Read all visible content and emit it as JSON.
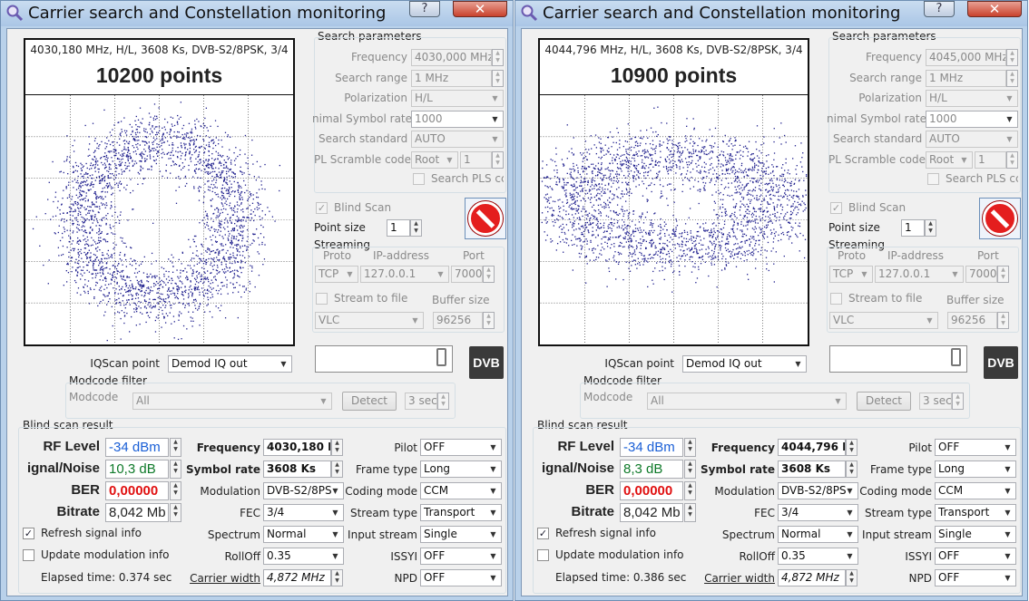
{
  "windows": [
    {
      "title": "Carrier search and Constellation monitoring",
      "plot": {
        "info": "4030,180 MHz, H/L, 3608 Ks, DVB-S2/8PSK, 3/4",
        "points": "10200 points"
      },
      "search": {
        "group": "Search parameters",
        "frequency_label": "Frequency",
        "frequency": "4030,000 MHz",
        "range_label": "Search range",
        "range": "1 MHz",
        "pol_label": "Polarization",
        "pol": "H/L",
        "minsr_label": "nimal Symbol rate",
        "minsr": "1000",
        "std_label": "Search standard",
        "std": "AUTO",
        "pls_label": "PL Scramble code",
        "pls_mode": "Root",
        "pls_val": "1",
        "searchpls": "Search PLS cc"
      },
      "blind": {
        "label": "Blind Scan",
        "pointsize_label": "Point size",
        "pointsize": "1"
      },
      "streaming": {
        "group": "Streaming",
        "proto_label": "Proto",
        "ip_label": "IP-address",
        "port_label": "Port",
        "proto": "TCP",
        "ip": "127.0.0.1",
        "port": "7000",
        "tofile": "Stream to file",
        "buffer_label": "Buffer size",
        "player": "VLC",
        "buffer": "96256"
      },
      "iq": {
        "label": "IQScan point",
        "value": "Demod IQ out"
      },
      "lcd": "0",
      "dvb": "DVB",
      "modcode": {
        "group": "Modcode filter",
        "label": "Modcode",
        "value": "All",
        "detect": "Detect",
        "secs": "3 sec"
      },
      "result": {
        "group": "Blind scan result",
        "rf_label": "RF Level",
        "rf": "-34 dBm",
        "sn_label": "ignal/Noise",
        "sn": "10,3 dB",
        "ber_label": "BER",
        "ber": "0,00000",
        "bitrate_label": "Bitrate",
        "bitrate": "8,042 Mb",
        "freq_label": "Frequency",
        "freq": "4030,180 M",
        "sr_label": "Symbol rate",
        "sr": "3608 Ks",
        "mod_label": "Modulation",
        "mod": "DVB-S2/8PS",
        "fec_label": "FEC",
        "fec": "3/4",
        "spectrum_label": "Spectrum",
        "spectrum": "Normal",
        "rolloff_label": "RollOff",
        "rolloff": "0.35",
        "carrier_label": "Carrier width",
        "carrier": "4,872 MHz",
        "pilot_label": "Pilot",
        "pilot": "OFF",
        "frame_label": "Frame type",
        "frame": "Long",
        "coding_label": "Coding mode",
        "coding": "CCM",
        "stype_label": "Stream type",
        "stype": "Transport",
        "input_label": "Input stream",
        "input": "Single",
        "issyi_label": "ISSYI",
        "issyi": "OFF",
        "npd_label": "NPD",
        "npd": "OFF",
        "refresh": "Refresh signal info",
        "update": "Update modulation info",
        "elapsed": "Elapsed time: 0.374 sec"
      }
    },
    {
      "title": "Carrier search and Constellation monitoring",
      "plot": {
        "info": "4044,796 MHz, H/L, 3608 Ks, DVB-S2/8PSK, 3/4",
        "points": "10900 points"
      },
      "search": {
        "group": "Search parameters",
        "frequency_label": "Frequency",
        "frequency": "4045,000 MHz",
        "range_label": "Search range",
        "range": "1 MHz",
        "pol_label": "Polarization",
        "pol": "H/L",
        "minsr_label": "nimal Symbol rate",
        "minsr": "1000",
        "std_label": "Search standard",
        "std": "AUTO",
        "pls_label": "PL Scramble code",
        "pls_mode": "Root",
        "pls_val": "1",
        "searchpls": "Search PLS cc"
      },
      "blind": {
        "label": "Blind Scan",
        "pointsize_label": "Point size",
        "pointsize": "1"
      },
      "streaming": {
        "group": "Streaming",
        "proto_label": "Proto",
        "ip_label": "IP-address",
        "port_label": "Port",
        "proto": "TCP",
        "ip": "127.0.0.1",
        "port": "7000",
        "tofile": "Stream to file",
        "buffer_label": "Buffer size",
        "player": "VLC",
        "buffer": "96256"
      },
      "iq": {
        "label": "IQScan point",
        "value": "Demod IQ out"
      },
      "lcd": "0",
      "dvb": "DVB",
      "modcode": {
        "group": "Modcode filter",
        "label": "Modcode",
        "value": "All",
        "detect": "Detect",
        "secs": "3 sec"
      },
      "result": {
        "group": "Blind scan result",
        "rf_label": "RF Level",
        "rf": "-34 dBm",
        "sn_label": "ignal/Noise",
        "sn": "8,3 dB",
        "ber_label": "BER",
        "ber": "0,00000",
        "bitrate_label": "Bitrate",
        "bitrate": "8,042 Mb",
        "freq_label": "Frequency",
        "freq": "4044,796 M",
        "sr_label": "Symbol rate",
        "sr": "3608 Ks",
        "mod_label": "Modulation",
        "mod": "DVB-S2/8PS",
        "fec_label": "FEC",
        "fec": "3/4",
        "spectrum_label": "Spectrum",
        "spectrum": "Normal",
        "rolloff_label": "RollOff",
        "rolloff": "0.35",
        "carrier_label": "Carrier width",
        "carrier": "4,872 MHz",
        "pilot_label": "Pilot",
        "pilot": "OFF",
        "frame_label": "Frame type",
        "frame": "Long",
        "coding_label": "Coding mode",
        "coding": "CCM",
        "stype_label": "Stream type",
        "stype": "Transport",
        "input_label": "Input stream",
        "input": "Single",
        "issyi_label": "ISSYI",
        "issyi": "OFF",
        "npd_label": "NPD",
        "npd": "OFF",
        "refresh": "Refresh signal info",
        "update": "Update modulation info",
        "elapsed": "Elapsed time: 0.386 sec"
      }
    }
  ],
  "colors": {
    "rf": "#1a5fd6",
    "sn": "#0f7a2a",
    "ber": "#e01010",
    "dots": "#1c1c8c"
  },
  "icons": {
    "app": "magnifier-icon",
    "help": "help-icon",
    "close": "close-icon",
    "stop": "stop-icon"
  }
}
